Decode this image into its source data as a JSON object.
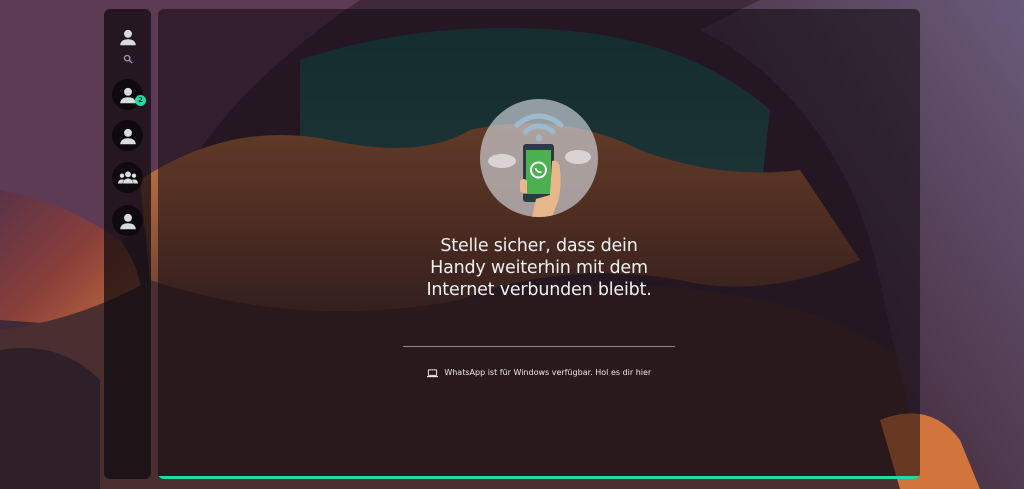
{
  "sidebar": {
    "items": [
      {
        "icon": "profile-icon"
      },
      {
        "icon": "search-icon"
      },
      {
        "icon": "contact-icon",
        "badge": "2"
      },
      {
        "icon": "contact-icon"
      },
      {
        "icon": "group-icon"
      },
      {
        "icon": "contact-icon"
      }
    ]
  },
  "main": {
    "headline": {
      "line1": "Stelle sicher, dass dein",
      "line2": "Handy weiterhin mit dem",
      "line3": "Internet verbunden bleibt."
    },
    "footer_link": "WhatsApp ist für Windows verfügbar. Hol es dir hier"
  },
  "colors": {
    "accent": "#25d9a6",
    "phone_screen": "#4caf50"
  }
}
